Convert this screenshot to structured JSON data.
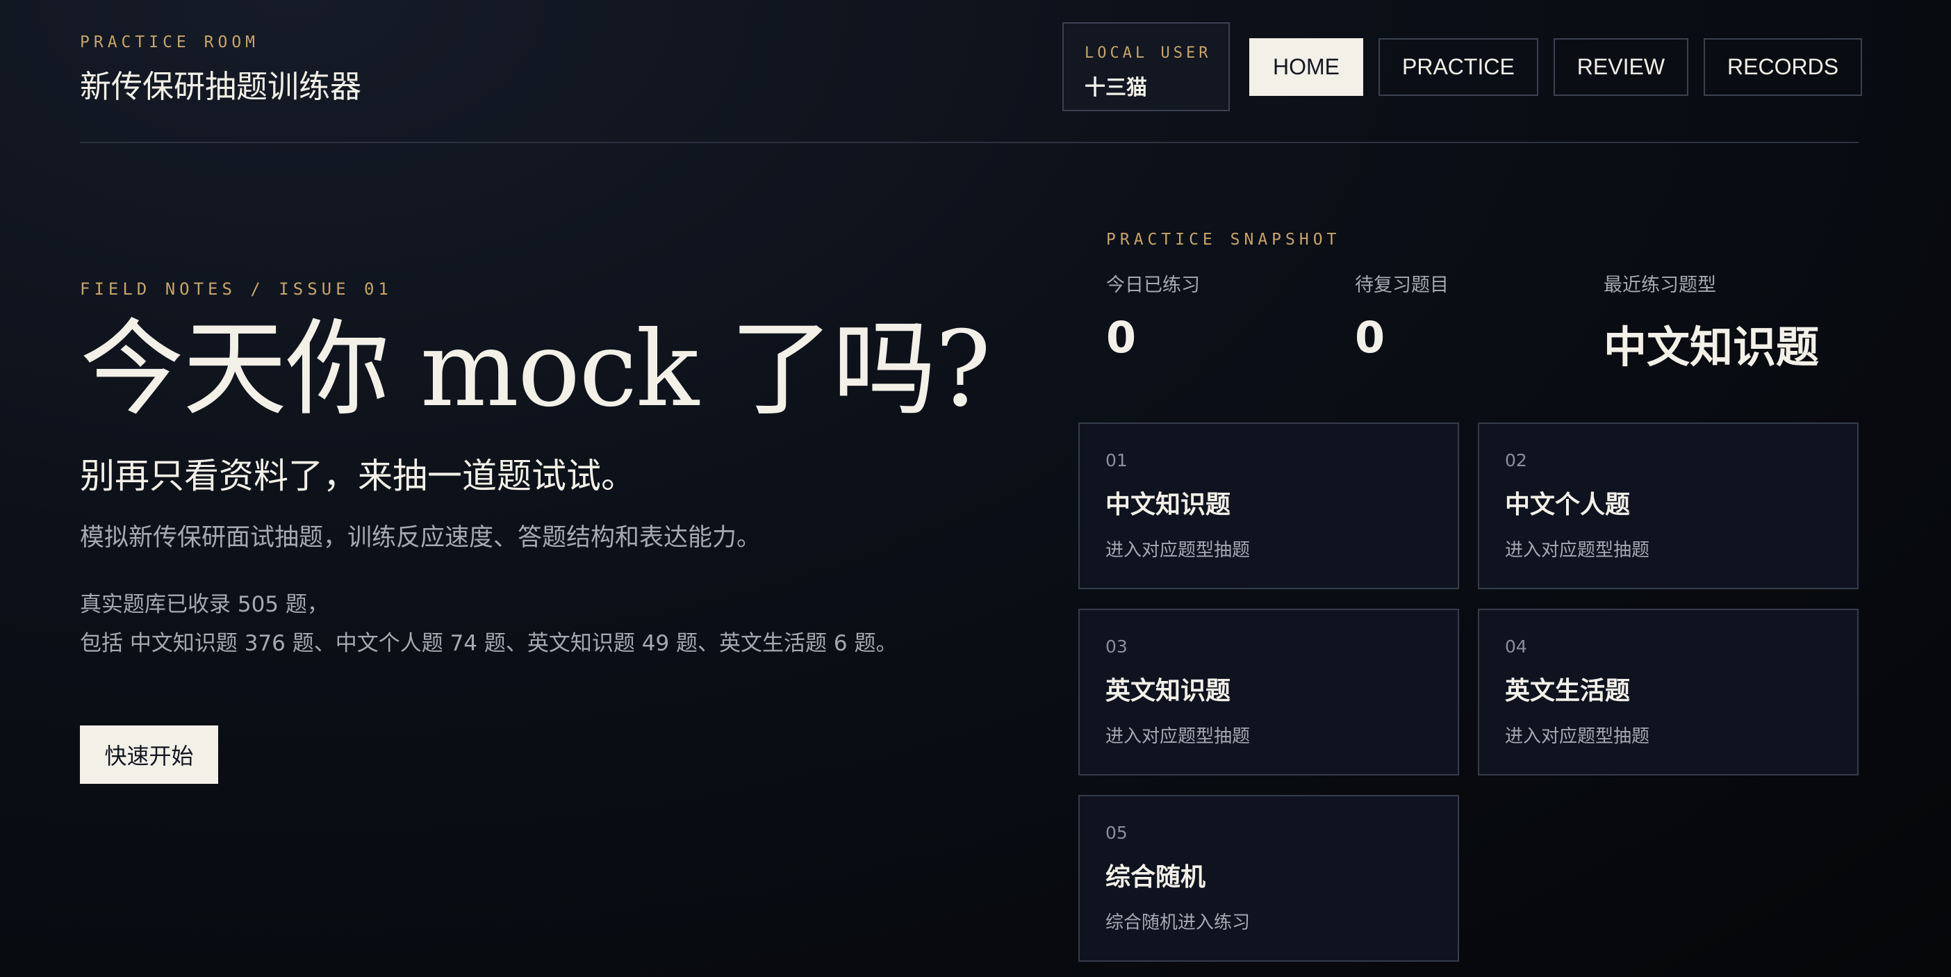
{
  "header": {
    "kicker": "PRACTICE ROOM",
    "title": "新传保研抽题训练器",
    "user": {
      "kicker": "LOCAL USER",
      "name": "十三猫"
    },
    "nav": [
      {
        "label": "HOME",
        "active": true
      },
      {
        "label": "PRACTICE"
      },
      {
        "label": "REVIEW"
      },
      {
        "label": "RECORDS"
      }
    ]
  },
  "hero": {
    "kicker": "FIELD NOTES / ISSUE 01",
    "title": "今天你 mock 了吗?",
    "subtitle": "别再只看资料了，来抽一道题试试。",
    "description": "模拟新传保研面试抽题，训练反应速度、答题结构和表达能力。",
    "stats_line1": "真实题库已收录 505 题，",
    "stats_line2": "包括 中文知识题 376 题、中文个人题 74 题、英文知识题 49 题、英文生活题 6 题。",
    "cta_label": "快速开始"
  },
  "snapshot": {
    "kicker": "PRACTICE SNAPSHOT",
    "stats": [
      {
        "label": "今日已练习",
        "value": "0"
      },
      {
        "label": "待复习题目",
        "value": "0"
      },
      {
        "label": "最近练习题型",
        "value": "中文知识题"
      }
    ]
  },
  "cards": [
    {
      "num": "01",
      "title": "中文知识题",
      "desc": "进入对应题型抽题"
    },
    {
      "num": "02",
      "title": "中文个人题",
      "desc": "进入对应题型抽题"
    },
    {
      "num": "03",
      "title": "英文知识题",
      "desc": "进入对应题型抽题"
    },
    {
      "num": "04",
      "title": "英文生活题",
      "desc": "进入对应题型抽题"
    },
    {
      "num": "05",
      "title": "综合随机",
      "desc": "综合随机进入练习"
    }
  ]
}
